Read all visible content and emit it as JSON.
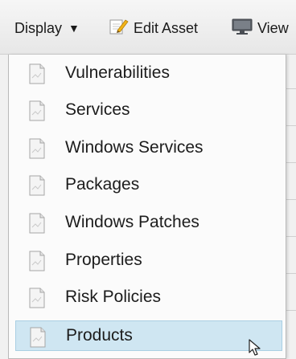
{
  "toolbar": {
    "display_label": "Display",
    "display_arrow": "▼",
    "edit_asset_label": "Edit Asset",
    "view_label": "View",
    "icons": {
      "edit": "pencil-document-icon",
      "view": "monitor-icon"
    }
  },
  "menu": {
    "selected_index": 7,
    "selected_color": "#cfe6f2",
    "item_icon": "document-icon",
    "items": [
      {
        "label": "Vulnerabilities"
      },
      {
        "label": "Services"
      },
      {
        "label": "Windows Services"
      },
      {
        "label": "Packages"
      },
      {
        "label": "Windows Patches"
      },
      {
        "label": "Properties"
      },
      {
        "label": "Risk Policies"
      },
      {
        "label": "Products"
      }
    ]
  }
}
